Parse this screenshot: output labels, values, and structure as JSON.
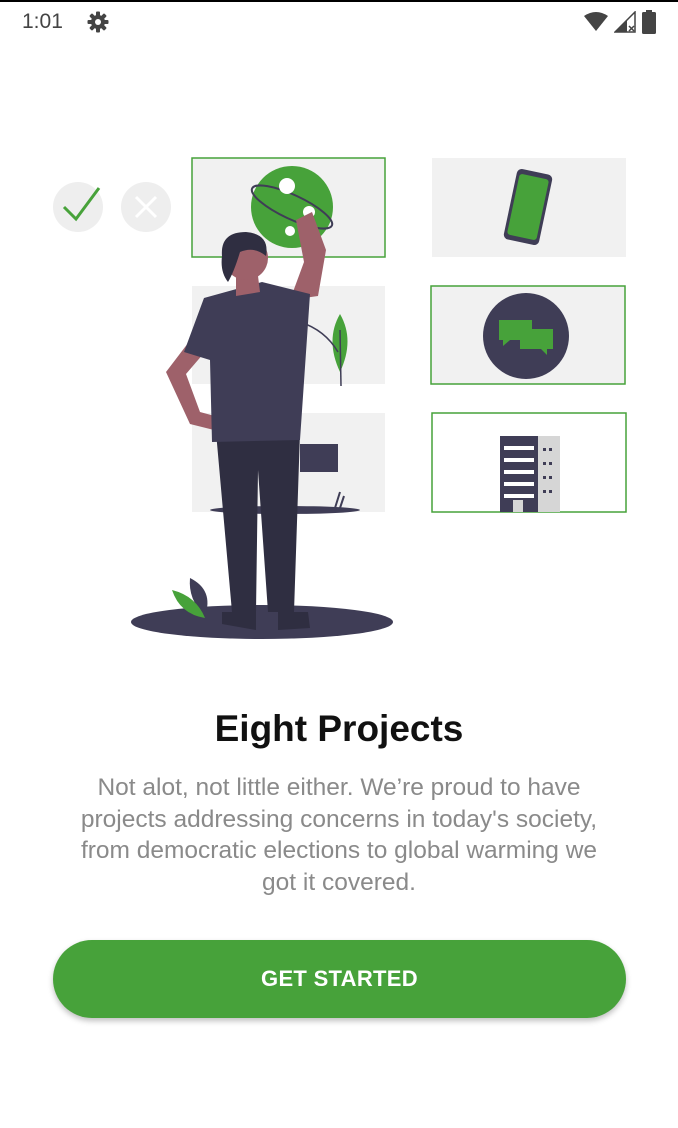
{
  "status_bar": {
    "time": "1:01",
    "icons": [
      "gear-icon",
      "wifi-icon",
      "cellular-signal-icon",
      "battery-icon"
    ]
  },
  "illustration": {
    "icons": [
      "checkmark-icon",
      "cross-icon",
      "globe-icon",
      "smartphone-icon",
      "chat-bubbles-icon",
      "building-icon",
      "person-figure",
      "leaf-icon"
    ]
  },
  "onboarding": {
    "title": "Eight Projects",
    "description": "Not alot, not little either. We’re proud to have projects addressing concerns in today's society, from democratic elections to global warming we got it covered.",
    "button_label": "GET STARTED"
  },
  "colors": {
    "accent": "#47a23a",
    "dark": "#3f3d56",
    "muted_text": "#8a8a8a",
    "panel": "#f1f1f1"
  }
}
